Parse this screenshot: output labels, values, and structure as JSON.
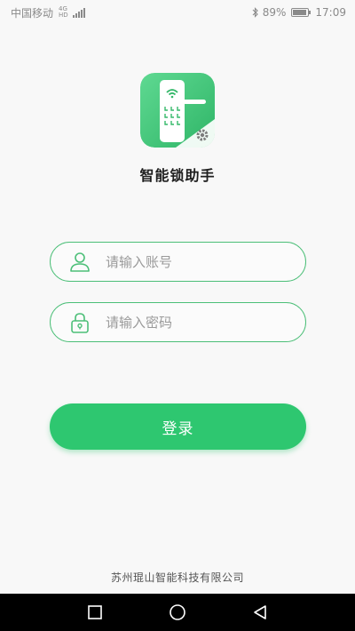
{
  "status_bar": {
    "carrier": "中国移动",
    "net_top": "4G",
    "net_bottom": "HD",
    "battery_percent": "89%",
    "battery_level": 0.89,
    "time": "17:09"
  },
  "app": {
    "title": "智能锁助手",
    "logo_icon": "smart-lock-logo-icon",
    "accent_color": "#2ec770",
    "border_color": "#4cbf78"
  },
  "login": {
    "account_placeholder": "请输入账号",
    "account_value": "",
    "password_placeholder": "请输入密码",
    "password_value": "",
    "submit_label": "登录"
  },
  "footer": {
    "company": "苏州琨山智能科技有限公司"
  },
  "nav": {
    "recent_icon": "square-icon",
    "home_icon": "circle-icon",
    "back_icon": "triangle-back-icon"
  }
}
